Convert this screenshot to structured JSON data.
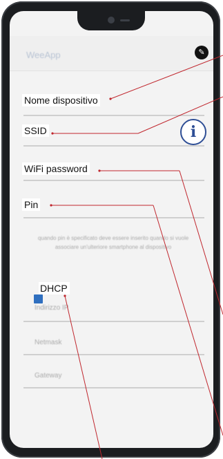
{
  "fields": {
    "device_name": "Nome dispositivo",
    "ssid": "SSID",
    "wifi_password": "WiFi password",
    "pin": "Pin",
    "dhcp": "DHCP"
  },
  "icons": {
    "info": "i",
    "edit": "✎"
  },
  "colors": {
    "callout_line": "#c0262d",
    "info_icon": "#2e4e95",
    "checkbox": "#2f6fbf"
  }
}
